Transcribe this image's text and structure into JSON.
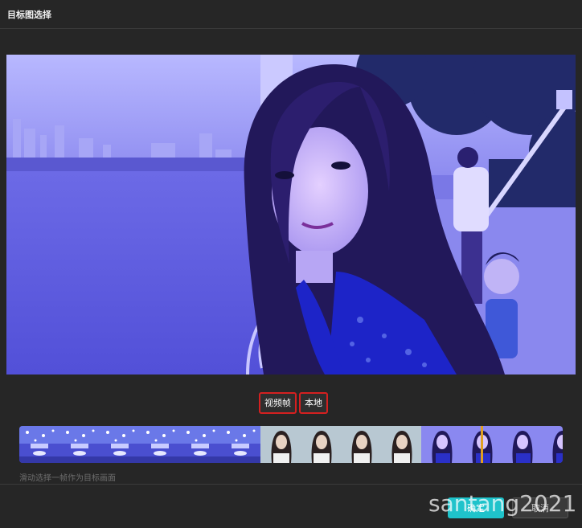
{
  "dialog": {
    "title": "目标图选择"
  },
  "preview": {
    "description_icon": "portrait-photo",
    "tint_color": "#6f6ee8"
  },
  "source_tabs": [
    {
      "label": "视频帧",
      "selected": true
    },
    {
      "label": "本地",
      "selected": false
    }
  ],
  "filmstrip": {
    "hint": "滑动选择一帧作为目标画面",
    "frames": [
      {
        "kind": "snow"
      },
      {
        "kind": "snow"
      },
      {
        "kind": "snow"
      },
      {
        "kind": "snow"
      },
      {
        "kind": "snow"
      },
      {
        "kind": "snow"
      },
      {
        "kind": "girl-natural"
      },
      {
        "kind": "girl-natural"
      },
      {
        "kind": "girl-natural"
      },
      {
        "kind": "girl-natural"
      },
      {
        "kind": "girl-blue"
      },
      {
        "kind": "girl-blue"
      },
      {
        "kind": "girl-blue"
      },
      {
        "kind": "girl-blue"
      }
    ]
  },
  "footer": {
    "confirm_label": "确定",
    "cancel_label": "取消"
  },
  "watermark": "santang2021",
  "colors": {
    "accent": "#1fc3cb",
    "tab_border": "#d42020",
    "background": "#262626"
  }
}
